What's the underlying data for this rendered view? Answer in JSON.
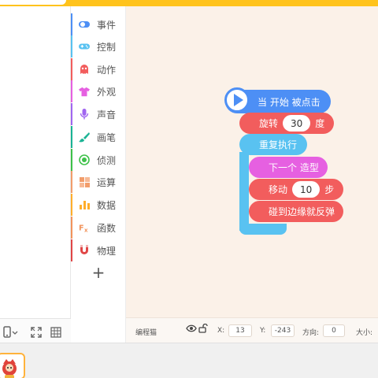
{
  "categories": [
    {
      "label": "事件",
      "icon": "toggle-icon",
      "color": "#4d8ff5"
    },
    {
      "label": "控制",
      "icon": "gamepad-icon",
      "color": "#59c2f1"
    },
    {
      "label": "动作",
      "icon": "ghost-icon",
      "color": "#f25d5d"
    },
    {
      "label": "外观",
      "icon": "shirt-icon",
      "color": "#e660e1"
    },
    {
      "label": "声音",
      "icon": "microphone-icon",
      "color": "#a066f0"
    },
    {
      "label": "画笔",
      "icon": "brush-icon",
      "color": "#1ab394"
    },
    {
      "label": "侦测",
      "icon": "radar-icon",
      "color": "#3ec14a"
    },
    {
      "label": "运算",
      "icon": "calculator-icon",
      "color": "#f29d6b"
    },
    {
      "label": "数据",
      "icon": "bar-chart-icon",
      "color": "#ffae2b"
    },
    {
      "label": "函数",
      "icon": "function-icon",
      "color": "#f2935b"
    },
    {
      "label": "物理",
      "icon": "magnet-icon",
      "color": "#e04646"
    }
  ],
  "add_category": "+",
  "blocks": {
    "when_start": "当 开始 被点击",
    "rotate_label": "旋转",
    "rotate_value": "30",
    "rotate_unit": "度",
    "repeat_forever": "重复执行",
    "next_costume": "下一个 造型",
    "move_label": "移动",
    "move_value": "10",
    "move_unit": "步",
    "bounce": "碰到边缘就反弹"
  },
  "status": {
    "sprite_name": "编程猫",
    "x_label": "X:",
    "x_value": "13",
    "y_label": "Y:",
    "y_value": "-243",
    "dir_label": "方向:",
    "dir_value": "0",
    "size_label": "大小:"
  },
  "colors": {
    "top_bar": "#ffc31c",
    "event": "#4d8ff5",
    "control": "#59c2f1",
    "motion": "#f25d5d",
    "looks": "#e660e1",
    "workspace": "#fbf1e8"
  }
}
